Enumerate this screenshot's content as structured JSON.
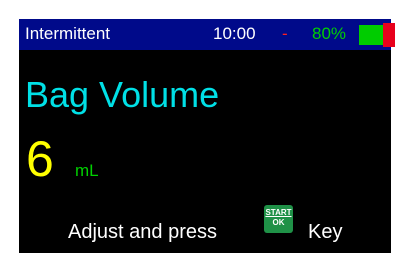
{
  "status_bar": {
    "mode": "Intermittent",
    "time": "10:00",
    "separator": "-",
    "battery_percent": "80%",
    "battery_icon": "battery-icon",
    "colors": {
      "background": "#000a8a",
      "separator": "#ff2020",
      "battery_percent": "#00d000",
      "battery_fill": "#00cc00",
      "battery_tip": "#e8001c"
    }
  },
  "main": {
    "title": "Bag Volume",
    "value": "6",
    "unit": "mL",
    "colors": {
      "title": "#00e0e6",
      "value": "#ffff00",
      "unit": "#00d000"
    }
  },
  "instruction": {
    "prefix": "Adjust and press",
    "key_label_top": "START",
    "key_label_bottom": "OK",
    "suffix": "Key",
    "key_color": "#1f9147"
  }
}
